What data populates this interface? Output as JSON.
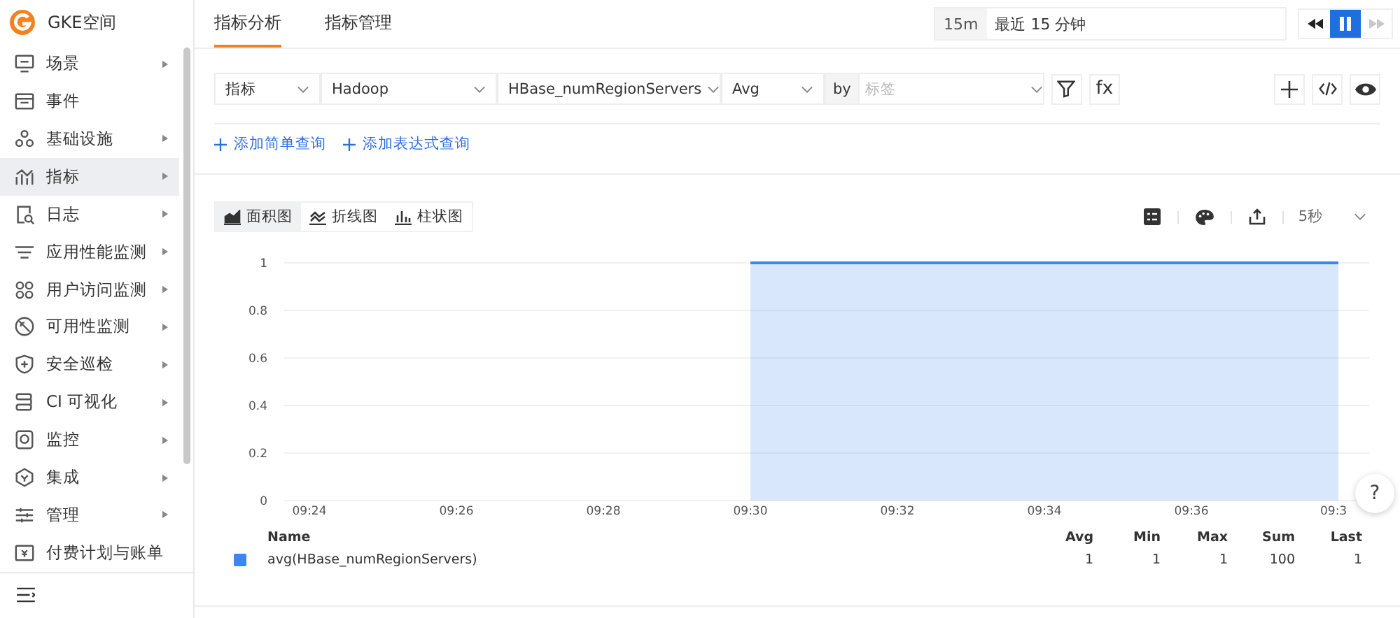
{
  "sidebar": {
    "brand": "GKE空间",
    "items": [
      {
        "label": "场景",
        "has_submenu": true,
        "selected": false
      },
      {
        "label": "事件",
        "has_submenu": false,
        "selected": false
      },
      {
        "label": "基础设施",
        "has_submenu": true,
        "selected": false
      },
      {
        "label": "指标",
        "has_submenu": true,
        "selected": true
      },
      {
        "label": "日志",
        "has_submenu": true,
        "selected": false
      },
      {
        "label": "应用性能监测",
        "has_submenu": true,
        "selected": false
      },
      {
        "label": "用户访问监测",
        "has_submenu": true,
        "selected": false
      },
      {
        "label": "可用性监测",
        "has_submenu": true,
        "selected": false
      },
      {
        "label": "安全巡检",
        "has_submenu": true,
        "selected": false
      },
      {
        "label": "CI 可视化",
        "has_submenu": true,
        "selected": false
      },
      {
        "label": "监控",
        "has_submenu": true,
        "selected": false
      },
      {
        "label": "集成",
        "has_submenu": true,
        "selected": false
      },
      {
        "label": "管理",
        "has_submenu": true,
        "selected": false
      },
      {
        "label": "付费计划与账单",
        "has_submenu": false,
        "selected": false
      }
    ]
  },
  "tabs": [
    {
      "label": "指标分析",
      "selected": true
    },
    {
      "label": "指标管理",
      "selected": false
    }
  ],
  "time_range": {
    "short": "15m",
    "value": "最近 15 分钟",
    "paused": true
  },
  "query": {
    "selects": [
      {
        "value": "指标"
      },
      {
        "value": "Hadoop"
      },
      {
        "value": "HBase_numRegionServers"
      },
      {
        "value": "Avg"
      }
    ],
    "by_label": "by",
    "by_placeholder": "标签",
    "function_button": "fx",
    "links": [
      "添加简单查询",
      "添加表达式查询"
    ]
  },
  "chart_types": [
    {
      "label": "面积图",
      "selected": true
    },
    {
      "label": "折线图",
      "selected": false
    },
    {
      "label": "柱状图",
      "selected": false
    }
  ],
  "refresh": "5秒",
  "chart": {
    "chart_data": {
      "type": "area",
      "categories": [
        "09:24",
        null,
        "09:26",
        null,
        "09:28",
        null,
        "09:30",
        null,
        "09:32",
        null,
        "09:34",
        null,
        "09:36",
        null,
        "09:3"
      ],
      "series": [
        {
          "name": "avg(HBase_numRegionServers)",
          "color": "#3b86f0",
          "values": [
            null,
            null,
            null,
            null,
            null,
            null,
            1,
            1,
            1,
            1,
            1,
            1,
            1,
            1,
            1
          ]
        }
      ],
      "ylim": [
        0,
        1
      ],
      "grid": true,
      "yticks": [
        0,
        0.2,
        0.4,
        0.6,
        0.8,
        1
      ]
    }
  },
  "legend": {
    "columns": [
      "Name",
      "Avg",
      "Min",
      "Max",
      "Sum",
      "Last"
    ],
    "rows": [
      {
        "values": [
          "1",
          "1",
          "1",
          "100",
          "1"
        ]
      }
    ]
  },
  "help_button": "?"
}
